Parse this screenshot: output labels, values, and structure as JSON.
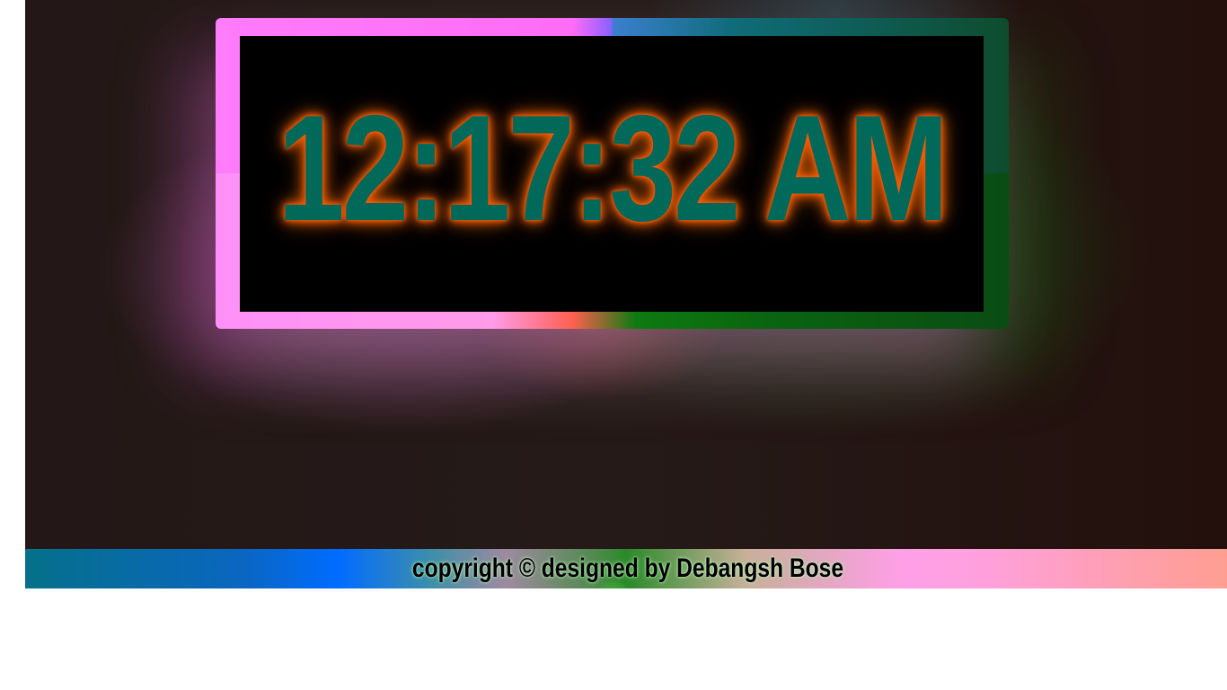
{
  "clock": {
    "time": "12:17:32 AM"
  },
  "footer": {
    "text": "copyright © designed by Debangsh Bose"
  },
  "colors": {
    "time_fill": "#00695a",
    "time_glow": "#ff5a00",
    "frame_left": "#ff7cfb",
    "frame_right": "#0a4c14",
    "background": "#241918"
  }
}
